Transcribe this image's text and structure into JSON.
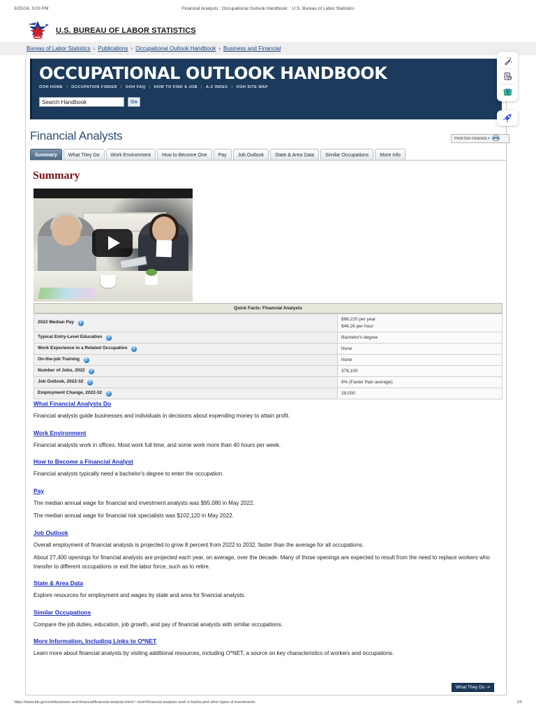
{
  "print_header": {
    "date": "3/25/24, 3:03 PM",
    "title": "Financial Analysts : Occupational Outlook Handbook: : U.S. Bureau of Labor Statistics"
  },
  "agency": {
    "name": "U.S. BUREAU OF LABOR STATISTICS",
    "logo_icon": "bls-star-logo"
  },
  "breadcrumb": {
    "items": [
      {
        "label": "Bureau of Labor Statistics"
      },
      {
        "label": "Publications"
      },
      {
        "label": "Occupational Outlook Handbook"
      },
      {
        "label": "Business and Financial"
      }
    ],
    "separator": "›"
  },
  "ooh": {
    "banner_title": "OCCUPATIONAL OUTLOOK HANDBOOK",
    "nav": [
      "OOH HOME",
      "OCCUPATION FINDER",
      "OOH FAQ",
      "HOW TO FIND A JOB",
      "A-Z INDEX",
      "OOH SITE MAP"
    ],
    "nav_separator": "|",
    "search": {
      "value": "Search Handbook",
      "placeholder": "Search Handbook",
      "button_label": "Go"
    },
    "banner_color": "#1b3a5c"
  },
  "occupation": {
    "title": "Financial Analysts",
    "printer_friendly_label": "PRINTER-FRIENDLY",
    "printer_icon": "printer-icon"
  },
  "tabs": {
    "items": [
      {
        "label": "Summary",
        "active": true
      },
      {
        "label": "What They Do",
        "active": false
      },
      {
        "label": "Work Environment",
        "active": false
      },
      {
        "label": "How to Become One",
        "active": false
      },
      {
        "label": "Pay",
        "active": false
      },
      {
        "label": "Job Outlook",
        "active": false
      },
      {
        "label": "State & Area Data",
        "active": false
      },
      {
        "label": "Similar Occupations",
        "active": false
      },
      {
        "label": "More Info",
        "active": false
      }
    ]
  },
  "summary": {
    "heading": "Summary",
    "heading_color": "#7b1113"
  },
  "video": {
    "play_icon": "play-button-icon",
    "alt": "Financial analysts meeting with clients video thumbnail"
  },
  "quick_facts": {
    "caption": "Quick Facts: Financial Analysts",
    "help_icon": "help-question-icon",
    "rows": [
      {
        "label": "2022 Median Pay",
        "value_lines": [
          "$96,220 per year",
          "$46.26 per hour"
        ]
      },
      {
        "label": "Typical Entry-Level Education",
        "value_lines": [
          "Bachelor's degree"
        ]
      },
      {
        "label": "Work Experience in a Related Occupation",
        "value_lines": [
          "None"
        ]
      },
      {
        "label": "On-the-job Training",
        "value_lines": [
          "None"
        ]
      },
      {
        "label": "Number of Jobs, 2022",
        "value_lines": [
          "376,100"
        ]
      },
      {
        "label": "Job Outlook, 2022-32",
        "value_lines": [
          "8% (Faster than average)"
        ]
      },
      {
        "label": "Employment Change, 2022-32",
        "value_lines": [
          "29,000"
        ]
      }
    ]
  },
  "sections": [
    {
      "heading": "What Financial Analysts Do",
      "paragraphs": [
        "Financial analysts guide businesses and individuals in decisions about expending money to attain profit."
      ]
    },
    {
      "heading": "Work Environment",
      "paragraphs": [
        "Financial analysts work in offices. Most work full time, and some work more than 40 hours per week."
      ]
    },
    {
      "heading": "How to Become a Financial Analyst",
      "paragraphs": [
        "Financial analysts typically need a bachelor's degree to enter the occupation."
      ]
    },
    {
      "heading": "Pay",
      "paragraphs": [
        "The median annual wage for financial and investment analysts was $95,080 in May 2022.",
        "The median annual wage for financial risk specialists was $102,120 in May 2022."
      ]
    },
    {
      "heading": "Job Outlook",
      "paragraphs": [
        "Overall employment of financial analysts is projected to grow 8 percent from 2022 to 2032, faster than the average for all occupations.",
        "About 27,400 openings for financial analysts are projected each year, on average, over the decade. Many of those openings are expected to result from the need to replace workers who transfer to different occupations or exit the labor force, such as to retire."
      ]
    },
    {
      "heading": "State & Area Data",
      "paragraphs": [
        "Explore resources for employment and wages by state and area for financial analysts."
      ]
    },
    {
      "heading": "Similar Occupations",
      "paragraphs": [
        "Compare the job duties, education, job growth, and pay of financial analysts with similar occupations."
      ]
    },
    {
      "heading": "More Information, Including Links to O*NET",
      "paragraphs": [
        "Learn more about financial analysts by visiting additional resources, including O*NET, a source on key characteristics of workers and occupations."
      ]
    }
  ],
  "next_button": {
    "label": "What They Do ->"
  },
  "print_footer": {
    "url": "https://www.bls.gov/ooh/business-and-financial/financial-analysts.htm#:~:text=Financial analysts work in banks,and other types of investments.",
    "page": "1/6"
  },
  "rail": {
    "items": [
      {
        "icon": "magic-wand-icon"
      },
      {
        "icon": "document-clock-icon"
      },
      {
        "icon": "gift-icon"
      }
    ],
    "rocket": {
      "icon": "rocket-icon",
      "color": "#3b57d6"
    }
  }
}
